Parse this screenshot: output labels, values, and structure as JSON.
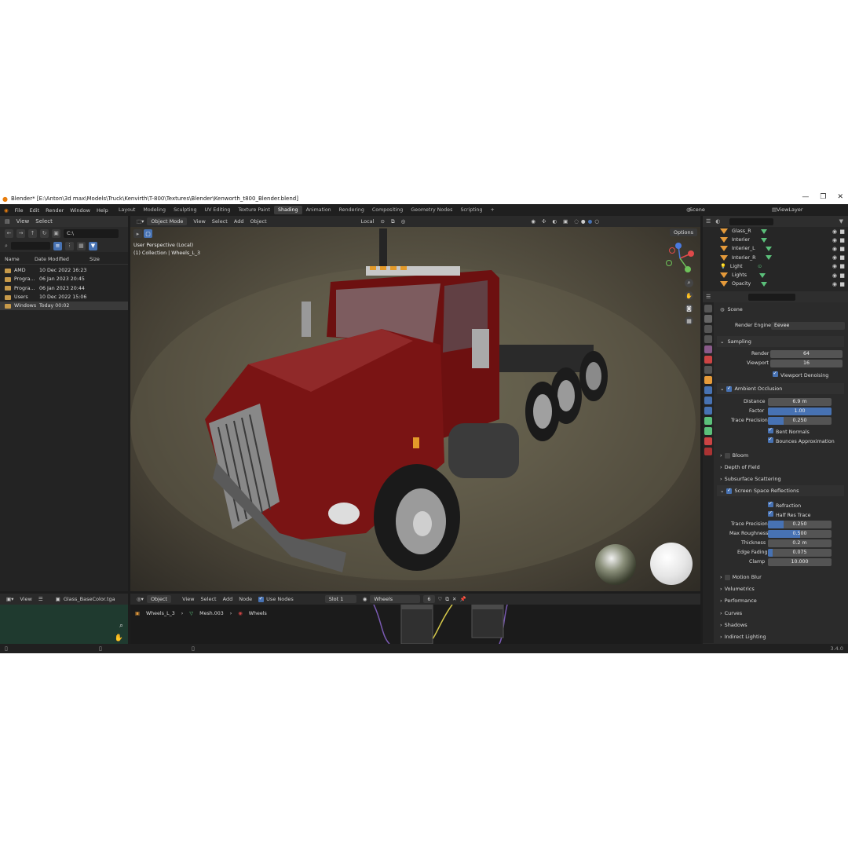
{
  "window": {
    "title": "Blender* [E:\\Anton\\3d max\\Models\\Truck\\Kenvirth\\T-800\\Textures\\Blender\\Kenworth_t800_Blender.blend]",
    "minimize": "—",
    "maximize": "❐",
    "close": "✕"
  },
  "menubar": {
    "items": [
      "File",
      "Edit",
      "Render",
      "Window",
      "Help"
    ],
    "workspaces": [
      "Layout",
      "Modeling",
      "Sculpting",
      "UV Editing",
      "Texture Paint",
      "Shading",
      "Animation",
      "Rendering",
      "Compositing",
      "Geometry Nodes",
      "Scripting",
      "+"
    ],
    "active_workspace": "Shading",
    "scene": "Scene",
    "view_layer": "ViewLayer"
  },
  "file_browser": {
    "header": [
      "View",
      "Select"
    ],
    "path": "C:\\",
    "columns": [
      "Name",
      "Date Modified",
      "Size"
    ],
    "rows": [
      {
        "name": "AMD",
        "date": "10 Dec 2022 16:23"
      },
      {
        "name": "Progra...",
        "date": "06 Jan 2023 20:45"
      },
      {
        "name": "Progra...",
        "date": "06 Jan 2023 20:44"
      },
      {
        "name": "Users",
        "date": "10 Dec 2022 15:06"
      },
      {
        "name": "Windows",
        "date": "Today 00:02"
      }
    ]
  },
  "viewport": {
    "mode": "Object Mode",
    "menus": [
      "View",
      "Select",
      "Add",
      "Object"
    ],
    "transform": "Local",
    "options": "Options",
    "overlay_line1": "User Perspective (Local)",
    "overlay_line2": "(1) Collection | Wheels_L_3"
  },
  "outliner": {
    "items": [
      "Glass_R",
      "Interier",
      "Interier_L",
      "Interier_R",
      "Light",
      "Lights",
      "Opacity"
    ]
  },
  "properties": {
    "scene_label": "Scene",
    "render_engine_label": "Render Engine",
    "render_engine": "Eevee",
    "sampling": {
      "title": "Sampling",
      "render_label": "Render",
      "render": "64",
      "viewport_label": "Viewport",
      "viewport": "16",
      "denoise": "Viewport Denoising"
    },
    "ao": {
      "title": "Ambient Occlusion",
      "distance_label": "Distance",
      "distance": "6.9 m",
      "factor_label": "Factor",
      "factor": "1.00",
      "trace_label": "Trace Precision",
      "trace": "0.250",
      "bent": "Bent Normals",
      "bounces": "Bounces Approximation"
    },
    "bloom": "Bloom",
    "dof": "Depth of Field",
    "sss": "Subsurface Scattering",
    "ssr": {
      "title": "Screen Space Reflections",
      "refraction": "Refraction",
      "half_res": "Half Res Trace",
      "trace_label": "Trace Precision",
      "trace": "0.250",
      "roughness_label": "Max Roughness",
      "roughness": "0.500",
      "thickness_label": "Thickness",
      "thickness": "0.2 m",
      "edge_label": "Edge Fading",
      "edge": "0.075",
      "clamp_label": "Clamp",
      "clamp": "10.000"
    },
    "collapsed": [
      "Motion Blur",
      "Volumetrics",
      "Performance",
      "Curves",
      "Shadows",
      "Indirect Lighting"
    ]
  },
  "node_editor": {
    "object": "Object",
    "menus": [
      "View",
      "Select",
      "Add",
      "Node"
    ],
    "use_nodes": "Use Nodes",
    "slot": "Slot 1",
    "material": "Wheels",
    "users": "6",
    "breadcrumb": [
      "Wheels_L_3",
      "Mesh.003",
      "Wheels"
    ]
  },
  "image_editor": {
    "view": "View",
    "image": "Glass_BaseColor.tga"
  },
  "status": {
    "version": "3.4.0"
  },
  "colors": {
    "accent": "#4772b3",
    "truck_red": "#7a1414",
    "folder": "#c79a4a"
  }
}
